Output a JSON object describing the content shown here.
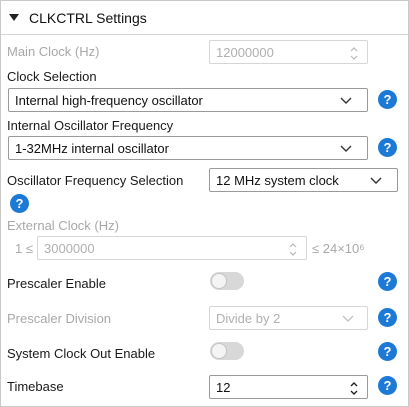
{
  "header": {
    "title": "CLKCTRL Settings"
  },
  "main_clock": {
    "label": "Main Clock (Hz)",
    "value": "12000000"
  },
  "clock_selection": {
    "label": "Clock Selection",
    "value": "Internal high-frequency oscillator"
  },
  "internal_osc_freq": {
    "label": "Internal Oscillator Frequency",
    "value": "1-32MHz internal oscillator"
  },
  "osc_freq_selection": {
    "label": "Oscillator Frequency Selection",
    "value": "12 MHz system clock"
  },
  "external_clock": {
    "label": "External Clock (Hz)",
    "min_label": "1 ≤",
    "value": "3000000",
    "max_label": "≤ 24×10⁶"
  },
  "prescaler_enable": {
    "label": "Prescaler Enable",
    "enabled": false
  },
  "prescaler_division": {
    "label": "Prescaler Division",
    "value": "Divide by 2"
  },
  "system_clock_out": {
    "label": "System Clock Out Enable",
    "enabled": false
  },
  "timebase": {
    "label": "Timebase",
    "value": "12"
  },
  "help_glyph": "?",
  "colors": {
    "help_blue": "#1c7ad6",
    "disabled_text": "#a8a8a8",
    "border": "#9a9a9a"
  }
}
